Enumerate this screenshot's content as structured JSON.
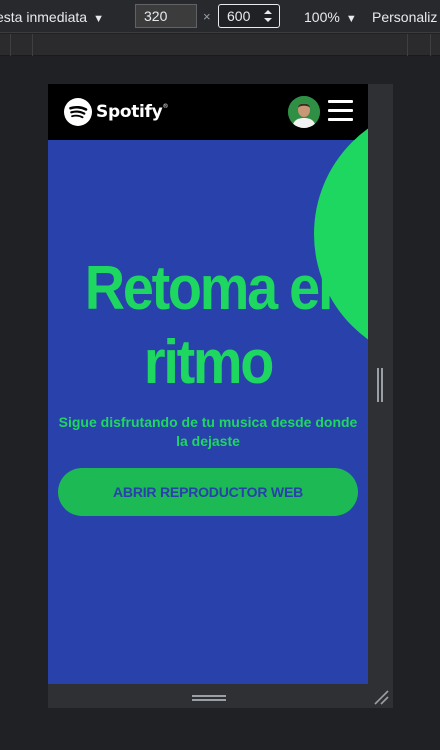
{
  "devtools": {
    "device_label": "esta inmediata",
    "width_value": "320",
    "height_value": "600",
    "times_sign": "×",
    "zoom": "100%",
    "customize_label": "Personaliz"
  },
  "header": {
    "brand_name": "Spotify",
    "brand_trademark": "®"
  },
  "hero": {
    "title_line1": "Retoma el",
    "title_line2": "ritmo",
    "subtitle": "Sigue disfrutando de tu musica desde donde la dejaste",
    "cta_label": "ABRIR REPRODUCTOR WEB"
  },
  "colors": {
    "spotify_green": "#1ed760",
    "hero_background": "#2941ab",
    "header_background": "#000000",
    "button_background": "#1db954"
  },
  "icons": {
    "device_caret": "chevron-down-icon",
    "zoom_caret": "chevron-down-icon",
    "height_spinner": "spinner-icon",
    "logo": "spotify-logo-icon",
    "menu": "hamburger-menu-icon",
    "avatar": "avatar",
    "side_handle": "resize-handle-icon",
    "bottom_handle": "resize-handle-icon",
    "corner_handle": "resize-corner-icon"
  }
}
